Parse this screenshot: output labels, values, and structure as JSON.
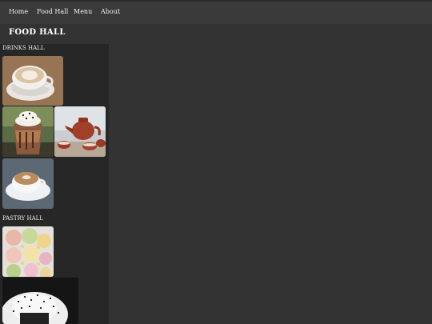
{
  "nav": {
    "items": [
      "Home",
      "Food Hall",
      "Menu",
      "About"
    ]
  },
  "site_title": "FOOD HALL",
  "sections": {
    "drinks": {
      "heading": "DRINKS HALL",
      "images": [
        "latte-art-cup",
        "iced-chocolate-drink",
        "teapot-with-cups",
        "cappuccino-cup"
      ]
    },
    "pastry": {
      "heading": "PASTRY HALL",
      "images": [
        "colorful-macaron-buns",
        "sesame-rice-balls"
      ]
    }
  },
  "colors": {
    "background": "#333333",
    "navbar": "#3a3a3a",
    "panel": "#272727",
    "text": "#ffffff"
  }
}
